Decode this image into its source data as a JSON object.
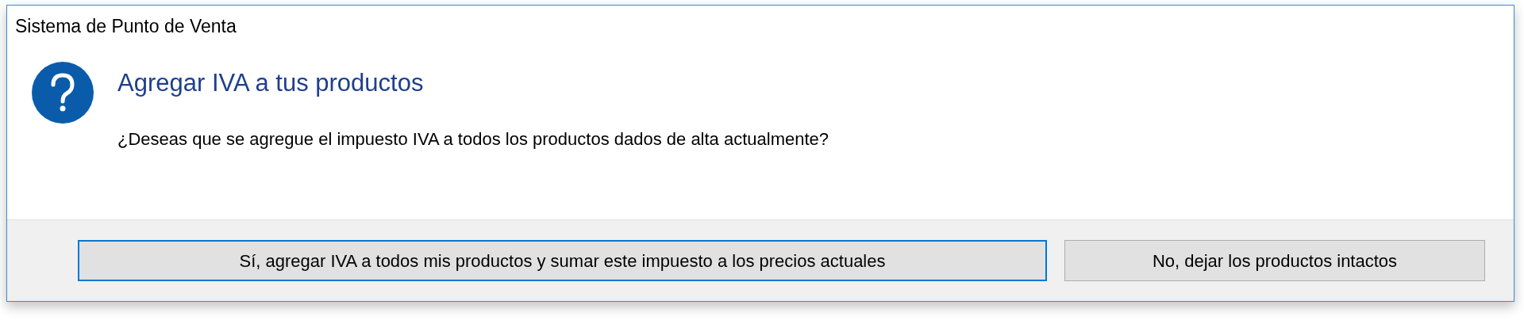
{
  "window": {
    "title": "Sistema de Punto de Venta"
  },
  "dialog": {
    "heading": "Agregar IVA a tus productos",
    "message": "¿Deseas que se agregue el impuesto IVA a todos los productos dados de alta actualmente?"
  },
  "buttons": [
    {
      "label": "Sí, agregar IVA a todos mis productos y sumar este impuesto a los precios actuales",
      "selected": true
    },
    {
      "label": "No, dejar los productos intactos",
      "selected": false
    }
  ]
}
